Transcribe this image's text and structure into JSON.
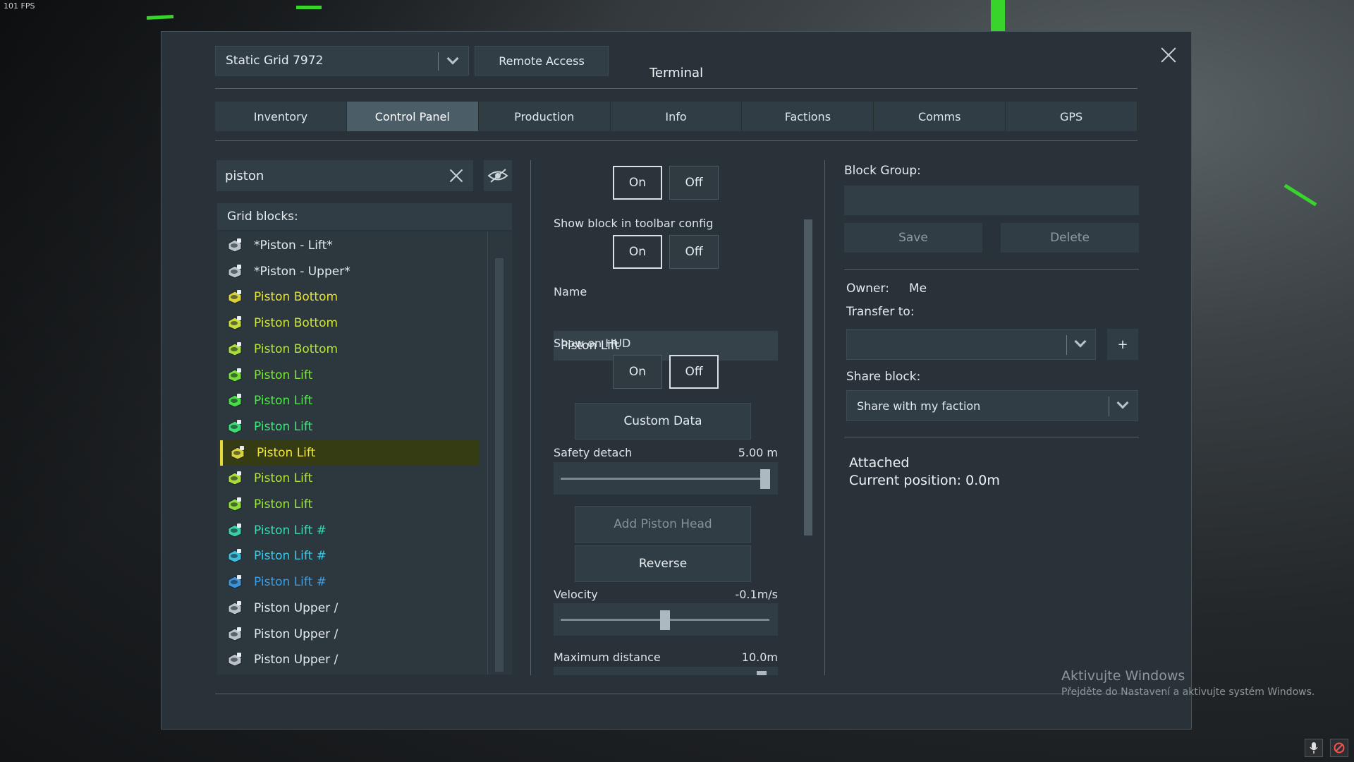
{
  "fps": "101 FPS",
  "header": {
    "grid_select": "Static Grid 7972",
    "remote_access": "Remote Access",
    "title": "Terminal"
  },
  "tabs": [
    {
      "label": "Inventory"
    },
    {
      "label": "Control Panel",
      "active": true
    },
    {
      "label": "Production"
    },
    {
      "label": "Info"
    },
    {
      "label": "Factions"
    },
    {
      "label": "Comms"
    },
    {
      "label": "GPS"
    }
  ],
  "left": {
    "search_value": "piston",
    "grid_blocks_label": "Grid blocks:",
    "blocks": [
      {
        "label": "*Piston - Lift*",
        "color": "#e4eaee",
        "icon": "#b8c2c8"
      },
      {
        "label": "*Piston - Upper*",
        "color": "#e4eaee",
        "icon": "#b8c2c8"
      },
      {
        "label": "Piston Bottom",
        "color": "#e6e23a",
        "icon": "#d8d23a"
      },
      {
        "label": "Piston Bottom",
        "color": "#d0e63a",
        "icon": "#c6dc3a"
      },
      {
        "label": "Piston Bottom",
        "color": "#b6e63a",
        "icon": "#a8dc3a"
      },
      {
        "label": "Piston Lift",
        "color": "#7fe63a",
        "icon": "#76dc3a"
      },
      {
        "label": "Piston Lift",
        "color": "#4fe64a",
        "icon": "#48dc48"
      },
      {
        "label": "Piston Lift",
        "color": "#3ee67a",
        "icon": "#3adc74"
      },
      {
        "label": "Piston Lift",
        "color": "#f0e63a",
        "icon": "#d8d23a",
        "selected": true
      },
      {
        "label": "Piston Lift",
        "color": "#b6e63a",
        "icon": "#a8dc3a"
      },
      {
        "label": "Piston Lift",
        "color": "#9ae63a",
        "icon": "#8edc3a"
      },
      {
        "label": "Piston Lift #",
        "color": "#3ed9b0",
        "icon": "#3acfa8"
      },
      {
        "label": "Piston Lift #",
        "color": "#3ec8e6",
        "icon": "#3abedc"
      },
      {
        "label": "Piston Lift #",
        "color": "#3a9ee6",
        "icon": "#3a94dc"
      },
      {
        "label": "Piston Upper /",
        "color": "#e4eaee",
        "icon": "#b8c2c8"
      },
      {
        "label": "Piston Upper /",
        "color": "#e4eaee",
        "icon": "#b8c2c8"
      },
      {
        "label": "Piston Upper /",
        "color": "#e4eaee",
        "icon": "#b8c2c8"
      }
    ]
  },
  "middle": {
    "on_label": "On",
    "off_label": "Off",
    "toolbar_config_label": "Show block in toolbar config",
    "name_label": "Name",
    "name_value": "Piston Lift",
    "show_hud_label": "Show on HUD",
    "custom_data": "Custom Data",
    "safety_detach_label": "Safety detach",
    "safety_detach_value": "5.00 m",
    "safety_detach_fraction": 0.98,
    "add_piston_head": "Add Piston Head",
    "reverse": "Reverse",
    "velocity_label": "Velocity",
    "velocity_value": "-0.1m/s",
    "velocity_fraction": 0.5,
    "max_distance_label": "Maximum distance",
    "max_distance_value": "10.0m"
  },
  "right": {
    "block_group_label": "Block Group:",
    "save": "Save",
    "delete": "Delete",
    "owner_label": "Owner:",
    "owner_value": "Me",
    "transfer_label": "Transfer to:",
    "plus": "+",
    "share_label": "Share block:",
    "share_value": "Share with my faction",
    "status_1": "Attached",
    "status_2": "Current position: 0.0m"
  },
  "watermark": {
    "line1": "Aktivujte Windows",
    "line2": "Přejděte do Nastavení a aktivujte systém Windows."
  }
}
